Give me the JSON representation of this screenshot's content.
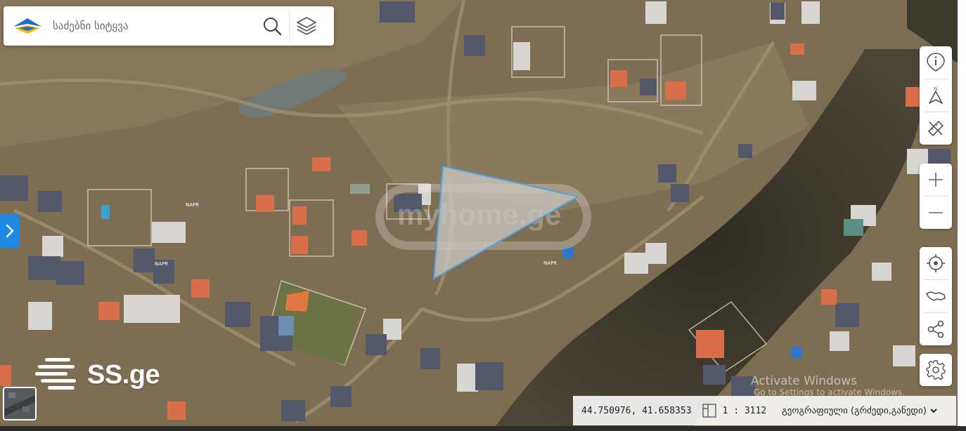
{
  "search": {
    "placeholder": "საძებნი სიტყვა"
  },
  "map": {
    "watermark_center": "myhome.ge",
    "watermark_corner": "SS.ge",
    "parcel_labels": [
      "NAPR",
      "NAPR",
      "NAPR"
    ]
  },
  "status": {
    "coordinates": "44.750976, 41.658353",
    "scale": "1 : 3112",
    "crs_label": "გეოგრაფიული (გრძედი,განედი)"
  },
  "os_overlay": {
    "line1": "Activate Windows",
    "line2": "Go to Settings to activate Windows."
  },
  "icons": {
    "search": "search-icon",
    "layers": "layers-icon",
    "info": "info-icon",
    "north": "north-arrow-icon",
    "measure": "ruler-pencil-icon",
    "zoom_in": "plus-icon",
    "zoom_out": "minus-icon",
    "locate": "crosshair-icon",
    "georgia": "georgia-map-icon",
    "share": "share-icon",
    "settings": "gear-icon",
    "expand": "chevron-right-icon",
    "crs_dropdown": "chevron-down-icon",
    "scale": "scale-icon"
  },
  "colors": {
    "parcel_outline": "#4fa3e0",
    "accent": "#1e88e5",
    "logo_blue": "#1f6fc4",
    "logo_yellow": "#f5b800"
  }
}
